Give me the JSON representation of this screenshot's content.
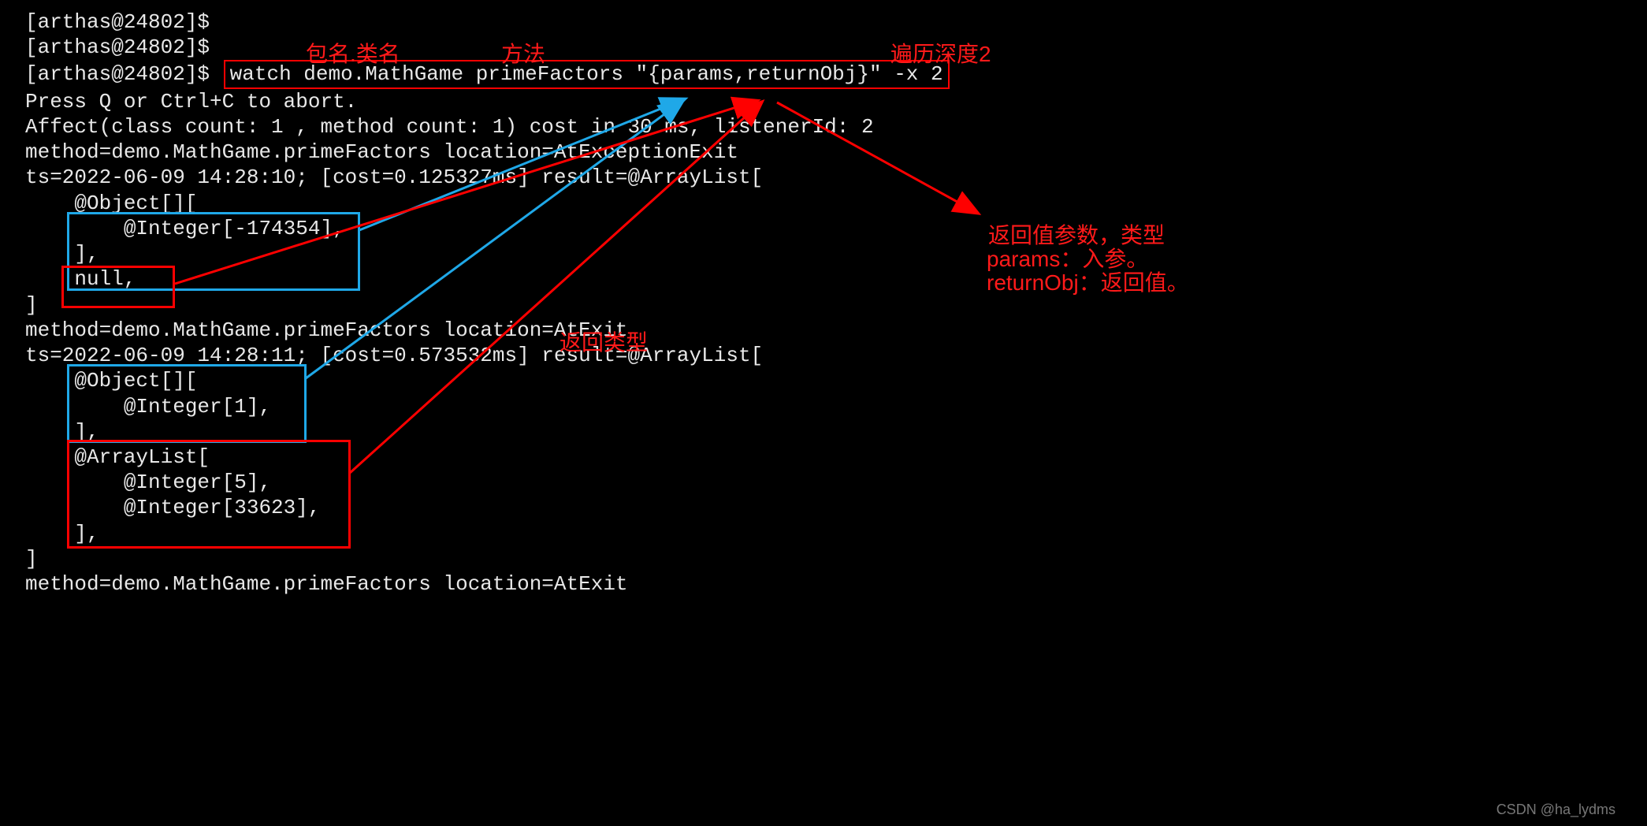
{
  "prompts": {
    "p0": "[arthas@24802]$",
    "p1": "[arthas@24802]$",
    "p2": "[arthas@24802]$"
  },
  "command": "watch demo.MathGame primeFactors \"{params,returnObj}\" -x 2",
  "output": {
    "l1": "Press Q or Ctrl+C to abort.",
    "l2": "Affect(class count: 1 , method count: 1) cost in 30 ms, listenerId: 2",
    "l3": "method=demo.MathGame.primeFactors location=AtExceptionExit",
    "l4": "ts=2022-06-09 14:28:10; [cost=0.125327ms] result=@ArrayList[",
    "l5": "    @Object[][",
    "l6": "        @Integer[-174354],",
    "l7": "    ],",
    "l8": "    null,",
    "l9": "]",
    "l10": "method=demo.MathGame.primeFactors location=AtExit",
    "l11": "ts=2022-06-09 14:28:11; [cost=0.573532ms] result=@ArrayList[",
    "l12": "    @Object[][",
    "l13": "        @Integer[1],",
    "l14": "    ],",
    "l15": "    @ArrayList[",
    "l16": "        @Integer[5],",
    "l17": "        @Integer[33623],",
    "l18": "    ],",
    "l19": "]",
    "l20": "method=demo.MathGame.primeFactors location=AtExit"
  },
  "annotations": {
    "pkg_class": "包名.类名",
    "method": "方法",
    "depth": "遍历深度2",
    "return_type": "返回类型",
    "ret_param_title": "返回值参数，类型",
    "ret_params": "params：入参。",
    "ret_returnObj": "returnObj：返回值。"
  },
  "watermark": "CSDN @ha_lydms"
}
